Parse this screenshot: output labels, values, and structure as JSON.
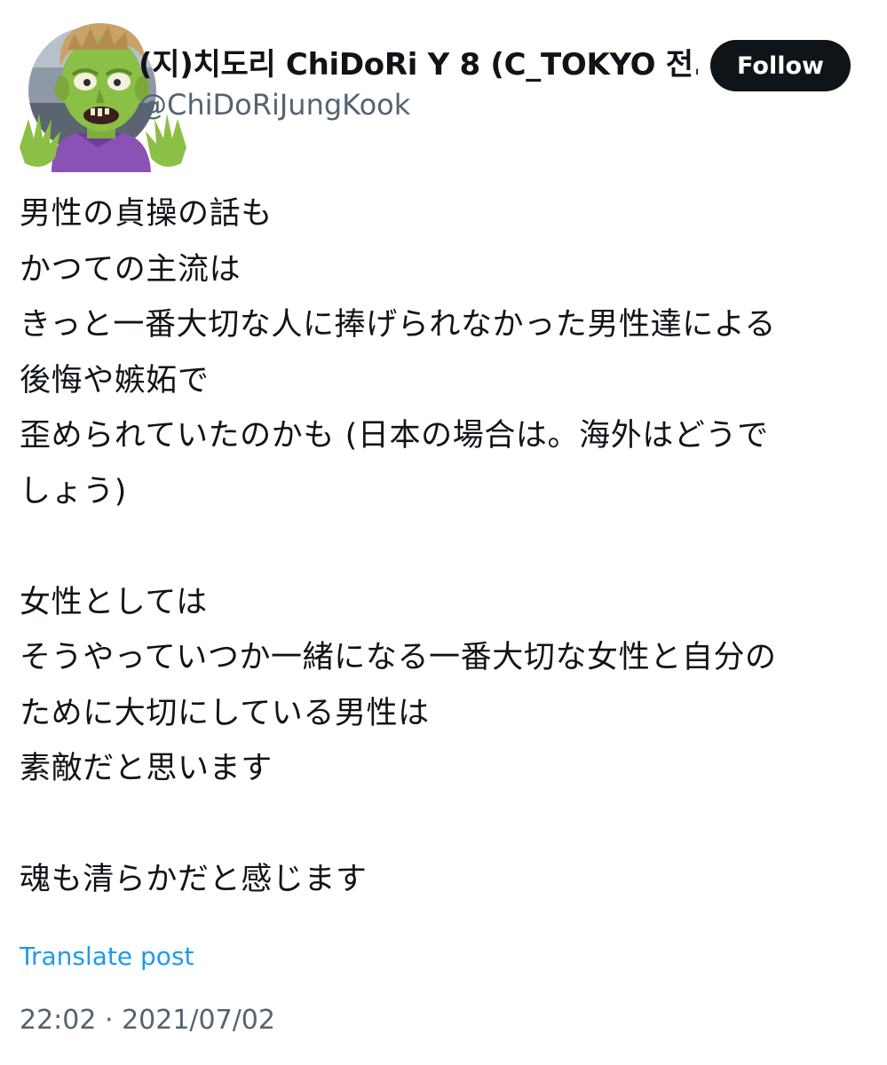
{
  "author": {
    "display_name": "(지)치도리 ChiDoRi Y 8 (C_TOKYO 전...",
    "handle": "@ChiDoRiJungKook",
    "avatar_icon": "zombie-emoji-avatar"
  },
  "actions": {
    "follow_label": "Follow"
  },
  "post": {
    "lines": [
      "男性の貞操の話も",
      "かつての主流は",
      "きっと一番大切な人に捧げられなかった男性達による",
      "後悔や嫉妬で",
      "歪められていたのかも (日本の場合は。海外はどうで",
      "しょう)",
      "",
      "女性としては",
      "そうやっていつか一緒になる一番大切な女性と自分の",
      "ために大切にしている男性は",
      "素敵だと思います",
      "",
      "魂も清らかだと感じます"
    ],
    "translate_label": "Translate post",
    "timestamp": "22:02 · 2021/07/02"
  },
  "colors": {
    "text_primary": "#0f1419",
    "text_secondary": "#536471",
    "link": "#1d9bf0",
    "follow_bg": "#0f1419",
    "follow_text": "#ffffff"
  }
}
